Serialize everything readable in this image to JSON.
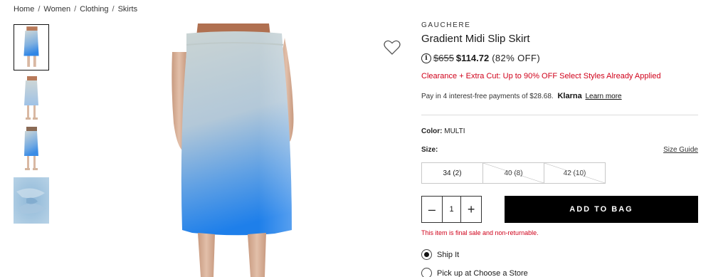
{
  "breadcrumb": {
    "items": [
      "Home",
      "Women",
      "Clothing",
      "Skirts"
    ],
    "separator": "/"
  },
  "gallery": {
    "thumbnails": [
      "skirt-front",
      "skirt-full-length",
      "skirt-side",
      "fabric-swatch"
    ],
    "selected_index": 0
  },
  "product": {
    "brand": "GAUCHERE",
    "title": "Gradient Midi Slip Skirt",
    "info_icon": "i",
    "original_price": "$655",
    "sale_price": "$114.72",
    "discount": "(82% OFF)",
    "promo": "Clearance + Extra Cut: Up to 90% OFF Select Styles Already Applied",
    "klarna": {
      "text": "Pay in 4 interest-free payments of $28.68.",
      "logo": "Klarna",
      "link": "Learn more"
    },
    "color_label": "Color:",
    "color_value": "MULTI",
    "size_label": "Size:",
    "size_guide": "Size Guide",
    "sizes": [
      {
        "label": "34 (2)",
        "available": true
      },
      {
        "label": "40 (8)",
        "available": false
      },
      {
        "label": "42 (10)",
        "available": false
      }
    ],
    "quantity": "1",
    "qty_minus": "–",
    "qty_plus": "+",
    "add_to_bag": "ADD TO BAG",
    "final_sale": "This item is final sale and non-returnable.",
    "fulfillment": [
      {
        "label": "Ship It",
        "selected": true
      },
      {
        "label": "Pick up at Choose a Store",
        "selected": false
      }
    ]
  },
  "colors": {
    "sale_red": "#d0021b",
    "button_black": "#000000",
    "skirt_top": "#c9d3d3",
    "skirt_bottom": "#2a86e8"
  }
}
